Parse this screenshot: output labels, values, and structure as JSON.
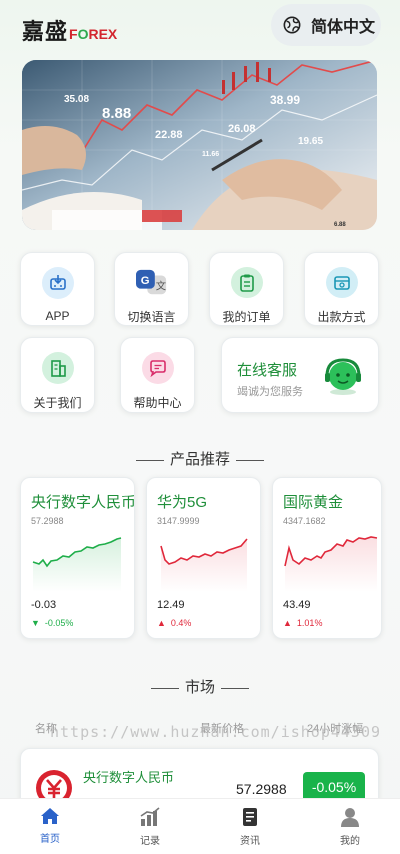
{
  "header": {
    "logo_cn": "嘉盛",
    "logo_en_pre": "F",
    "logo_en_o": "O",
    "logo_en_post": "REX",
    "language_label": "简体中文"
  },
  "banner": {
    "numbers": [
      "35.08",
      "8.88",
      "22.88",
      "26.08",
      "38.99",
      "19.65",
      "11.66",
      "6.88"
    ]
  },
  "quick_menu": [
    {
      "label": "APP",
      "icon": "app-download-icon"
    },
    {
      "label": "切换语言",
      "icon": "translate-icon"
    },
    {
      "label": "我的订单",
      "icon": "order-icon"
    },
    {
      "label": "出款方式",
      "icon": "withdraw-icon"
    },
    {
      "label": "关于我们",
      "icon": "building-icon"
    },
    {
      "label": "帮助中心",
      "icon": "chat-help-icon"
    }
  ],
  "service": {
    "title": "在线客服",
    "subtitle": "竭诚为您服务"
  },
  "products_title": "产品推荐",
  "products": [
    {
      "name": "央行数字人民币",
      "price": "57.2988",
      "change": "-0.03",
      "percent": "-0.05%",
      "direction": "down",
      "color": "#1fae4a"
    },
    {
      "name": "华为5G",
      "price": "3147.9999",
      "change": "12.49",
      "percent": "0.4%",
      "direction": "up",
      "color": "#e0283b"
    },
    {
      "name": "国际黄金",
      "price": "4347.1682",
      "change": "43.49",
      "percent": "1.01%",
      "direction": "up",
      "color": "#e0283b"
    }
  ],
  "market": {
    "title": "市场",
    "col_name": "名称",
    "col_price": "最新价格",
    "col_change": "24小时涨幅",
    "watermark": "https://www.huzhan.com/ishop44309",
    "rows": [
      {
        "name": "央行数字人民币",
        "price": "57.2988",
        "change": "-0.05%"
      }
    ]
  },
  "tabs": [
    {
      "label": "首页",
      "icon": "home-icon",
      "active": true
    },
    {
      "label": "记录",
      "icon": "bar-chart-icon",
      "active": false
    },
    {
      "label": "资讯",
      "icon": "document-icon",
      "active": false
    },
    {
      "label": "我的",
      "icon": "user-icon",
      "active": false
    }
  ],
  "colors": {
    "brand_green": "#1f8f3a",
    "up_red": "#e0283b",
    "down_green": "#1fae4a",
    "active_tab": "#2a62c9"
  }
}
